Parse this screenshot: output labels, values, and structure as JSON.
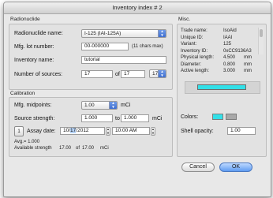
{
  "window": {
    "title": "Inventory index # 2"
  },
  "radionuclide": {
    "group_label": "Radionuclide",
    "name_label": "Radionuclide name:",
    "name_value": "I-125 (IAI-125A)",
    "lot_label": "Mfg. lot number:",
    "lot_value": "00-000000",
    "lot_hint": "(11 chars max)",
    "inventory_label": "Inventory name:",
    "inventory_value": "tutorial",
    "sources_label": "Number of sources:",
    "sources_value": "17",
    "of_label": "of",
    "sources_total": "17",
    "sources_popup": "17"
  },
  "calibration": {
    "group_label": "Calibration",
    "midpoints_label": "Mfg. midpoints:",
    "midpoints_value": "1.00",
    "midpoints_unit": "mCi",
    "strength_label": "Source strength:",
    "strength_min": "1.000",
    "to_label": "to",
    "strength_max": "1.000",
    "strength_unit": "mCi",
    "calendar_day": "1",
    "assay_label": "Assay date:",
    "assay_date_pre": "10/",
    "assay_date_day": "17",
    "assay_date_post": "/2012",
    "assay_time": "10:00 AM",
    "avg_text": "Avg.= 1.000",
    "available_label": "Available strength",
    "available_value": "17.00",
    "available_of": "of",
    "available_total": "17.00",
    "available_unit": "mCi"
  },
  "misc": {
    "group_label": "Misc.",
    "rows": [
      {
        "key": "Trade name:",
        "value": "IsoAid"
      },
      {
        "key": "Unique ID:",
        "value": "IAAI"
      },
      {
        "key": "Variant:",
        "value": "125"
      },
      {
        "key": "Inventory ID:",
        "value": "0xCC9136A3"
      },
      {
        "key": "Physical length:",
        "value": "4.500",
        "unit": "mm"
      },
      {
        "key": "Diameter:",
        "value": "0.800",
        "unit": "mm"
      },
      {
        "key": "Active length:",
        "value": "3.000",
        "unit": "mm"
      }
    ],
    "colors_label": "Colors:",
    "opacity_label": "Shell opacity:",
    "opacity_value": "1.00",
    "preview_color": "#33e0e8",
    "color1": "#33e0e8",
    "color2": "#a8a8a8"
  },
  "buttons": {
    "cancel": "Cancel",
    "ok": "OK"
  }
}
